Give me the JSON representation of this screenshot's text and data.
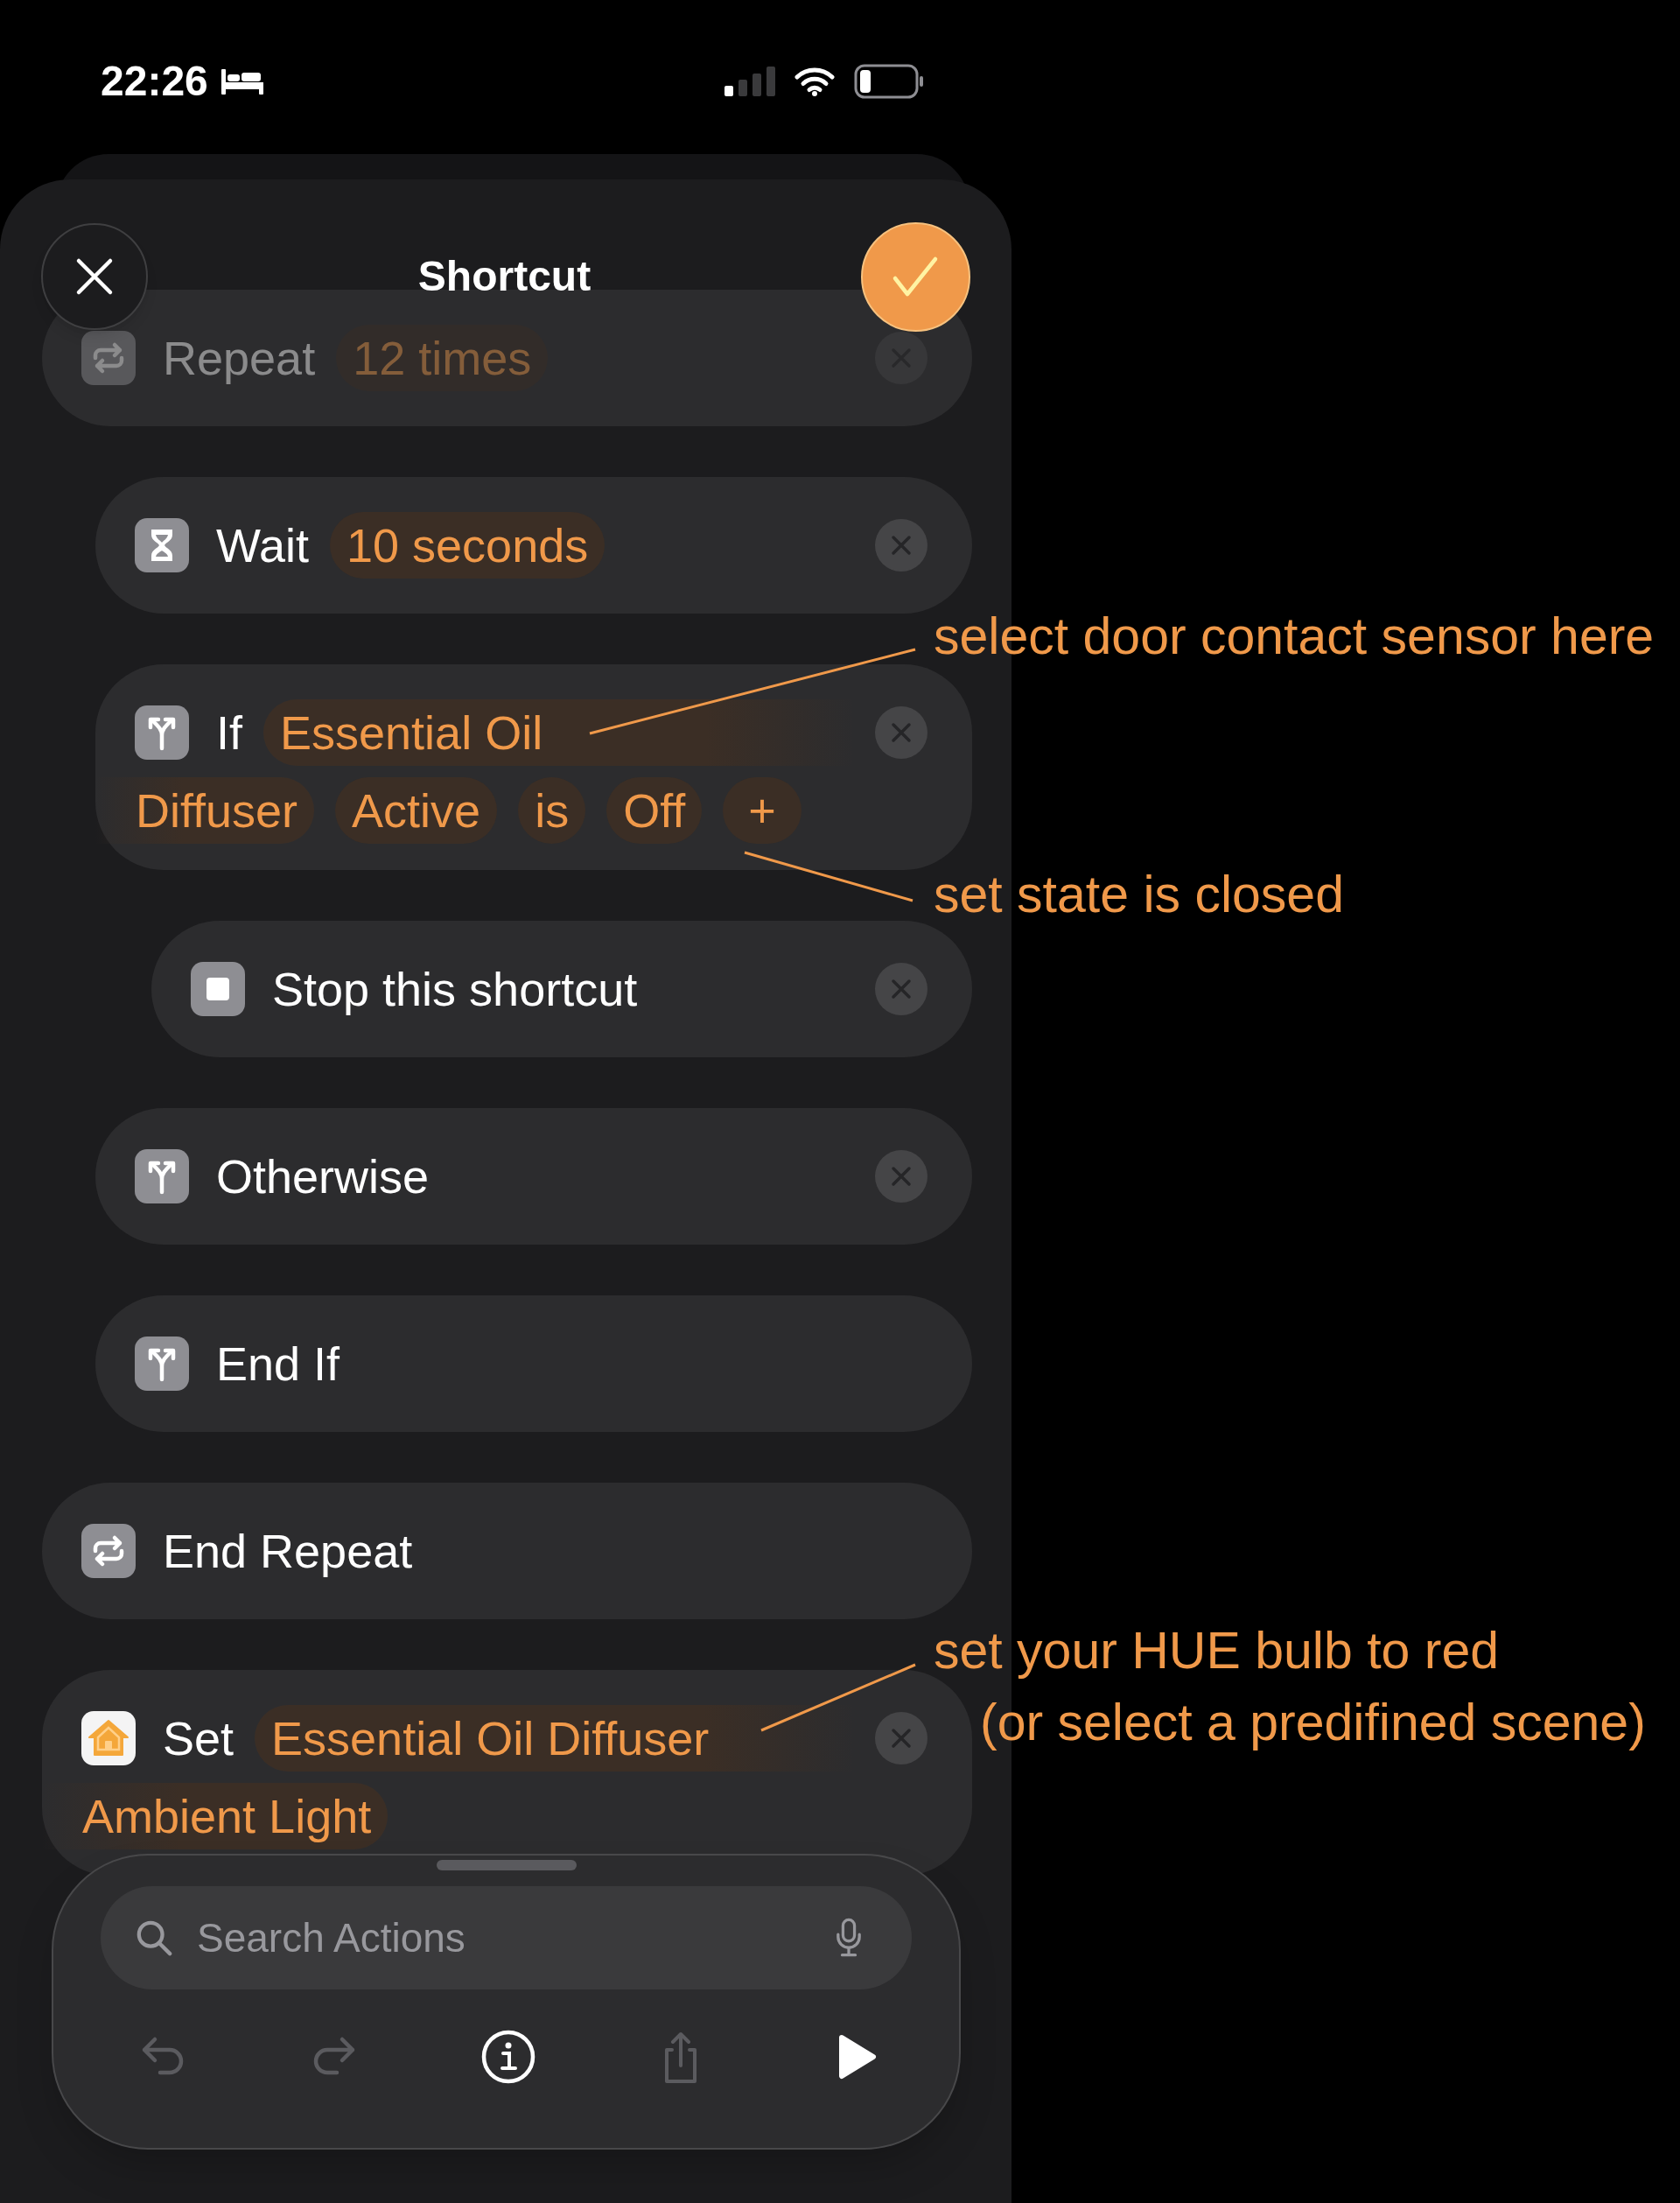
{
  "status_bar": {
    "time": "22:26"
  },
  "header": {
    "title": "Shortcut"
  },
  "actions": [
    {
      "kind": "loop",
      "faded": true,
      "deletable": true,
      "lines": [
        [
          {
            "kind": "label",
            "text": "Repeat"
          },
          {
            "kind": "token",
            "text": "12 times"
          }
        ]
      ],
      "children": [
        {
          "kind": "wait",
          "faded": false,
          "deletable": true,
          "lines": [
            [
              {
                "kind": "label",
                "text": "Wait"
              },
              {
                "kind": "token",
                "text": "10 seconds"
              }
            ]
          ]
        },
        {
          "kind": "branch",
          "faded": false,
          "deletable": true,
          "lines": [
            [
              {
                "kind": "label",
                "text": "If"
              },
              {
                "kind": "token_head",
                "text": "Essential Oil"
              }
            ],
            [
              {
                "kind": "token_tail",
                "text": "Diffuser"
              },
              {
                "kind": "token",
                "text": "Active"
              },
              {
                "kind": "token",
                "text": "is"
              },
              {
                "kind": "token",
                "text": "Off"
              },
              {
                "kind": "add",
                "text": "+"
              }
            ]
          ],
          "children": [
            {
              "kind": "stop",
              "faded": false,
              "deletable": true,
              "lines": [
                [
                  {
                    "kind": "label",
                    "text": "Stop this shortcut"
                  }
                ]
              ]
            }
          ]
        },
        {
          "kind": "branch",
          "faded": false,
          "deletable": true,
          "lines": [
            [
              {
                "kind": "label",
                "text": "Otherwise"
              }
            ]
          ]
        },
        {
          "kind": "branch",
          "faded": false,
          "deletable": false,
          "lines": [
            [
              {
                "kind": "label",
                "text": "End If"
              }
            ]
          ]
        }
      ]
    },
    {
      "kind": "loop",
      "faded": false,
      "deletable": false,
      "lines": [
        [
          {
            "kind": "label",
            "text": "End Repeat"
          }
        ]
      ]
    },
    {
      "kind": "home",
      "faded": false,
      "deletable": true,
      "lines": [
        [
          {
            "kind": "label",
            "text": "Set"
          },
          {
            "kind": "token_head",
            "text": "Essential Oil Diffuser"
          }
        ],
        [
          {
            "kind": "token_tail",
            "text": "Ambient Light"
          }
        ]
      ]
    }
  ],
  "search": {
    "placeholder": "Search Actions"
  },
  "toolbar": [
    {
      "kind": "undo",
      "disabled": true
    },
    {
      "kind": "redo",
      "disabled": true
    },
    {
      "kind": "info",
      "disabled": false
    },
    {
      "kind": "share",
      "disabled": true
    },
    {
      "kind": "run",
      "disabled": false
    }
  ],
  "annotations": [
    {
      "lines": [
        "select door contact sensor here"
      ]
    },
    {
      "lines": [
        "set state is closed"
      ]
    },
    {
      "lines": [
        "set your HUE bulb to red",
        "(or select a predifined scene)"
      ]
    }
  ]
}
